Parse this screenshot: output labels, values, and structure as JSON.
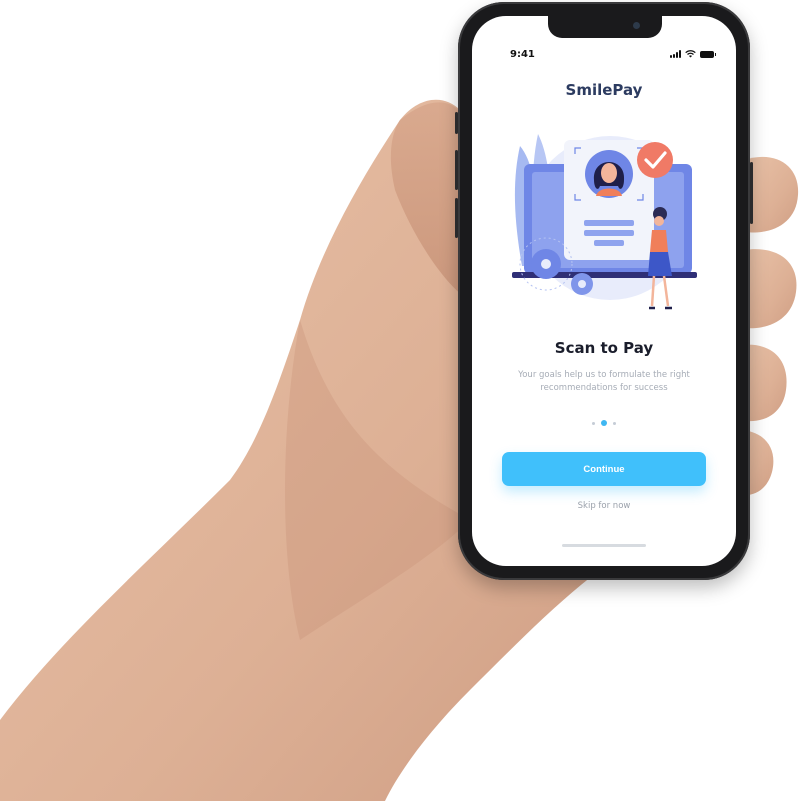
{
  "status_bar": {
    "time": "9:41"
  },
  "app": {
    "title": "SmilePay"
  },
  "onboarding": {
    "headline": "Scan to Pay",
    "subtext": "Your goals help us to formulate the right recommendations for success",
    "page_indicator": {
      "total": 3,
      "active_index": 1
    },
    "continue_label": "Continue",
    "skip_label": "Skip for now"
  },
  "colors": {
    "brand_title": "#2c3b60",
    "primary_button": "#40c0fb",
    "active_dot": "#3fb7f2",
    "illustration_blue": "#6f86e6"
  }
}
